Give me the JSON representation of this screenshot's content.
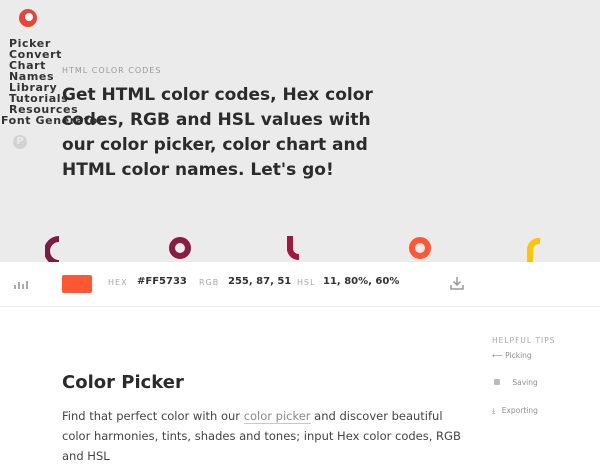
{
  "nav": {
    "items": [
      "Picker",
      "Convert",
      "Chart",
      "Names",
      "Library",
      "Tutorials",
      "Resources",
      "Font Generator"
    ]
  },
  "hero": {
    "eyebrow": "HTML COLOR CODES",
    "headline": "Get HTML color codes, Hex color codes, RGB and HSL values with our color picker, color chart and HTML color names. Let's go!",
    "background": "#ebebeb"
  },
  "colors": {
    "deco1": "#7a1d46",
    "deco2": "#8a1c44",
    "deco3": "#a0183f",
    "deco4": "#ff5733",
    "deco5": "#ffc300",
    "logo": "#e8443a"
  },
  "colorbar": {
    "swatch": "#FF5733",
    "hex_label": "HEX",
    "hex_value": "#FF5733",
    "rgb_label": "RGB",
    "rgb_value": "255, 87, 51",
    "hsl_label": "HSL",
    "hsl_value": "11, 80%, 60%",
    "icons": [
      "chart-bars-icon",
      "download-icon"
    ]
  },
  "tips": {
    "heading": "HELPFUL TIPS",
    "items": [
      "Picking",
      "Saving",
      "Exporting"
    ],
    "icons": [
      "arrow-left-icon",
      "lock-icon",
      "download-icon"
    ]
  },
  "content": {
    "title": "Color Picker",
    "text_before": "Find that perfect color with our ",
    "link_text": "color picker",
    "text_after": " and discover beautiful color harmonies, tints, shades and tones; input Hex color codes, RGB and HSL"
  }
}
